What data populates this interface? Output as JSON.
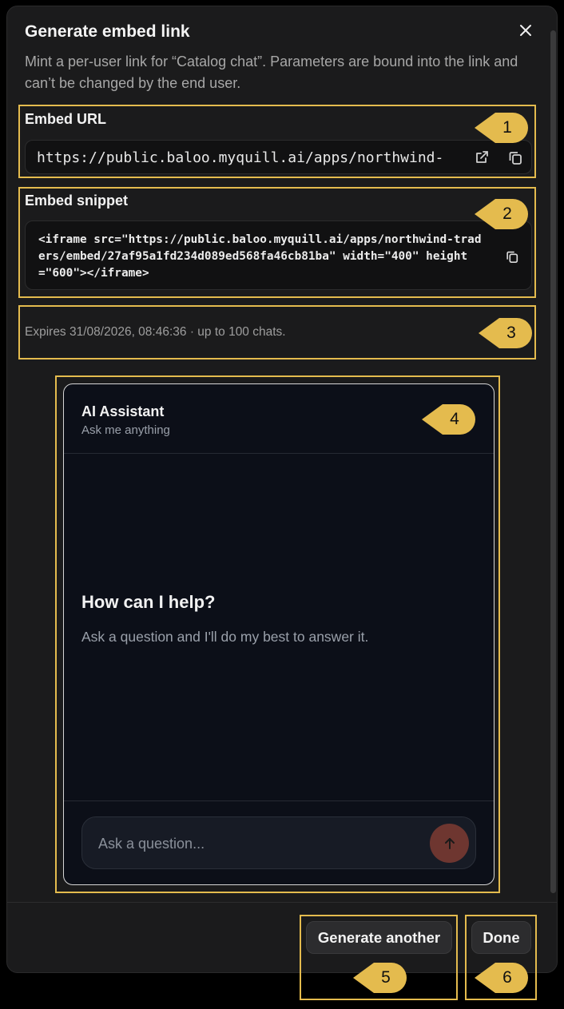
{
  "dialog": {
    "title": "Generate embed link",
    "description": "Mint a per-user link for “Catalog chat”. Parameters are bound into the link and can’t be changed by the end user.",
    "close_icon": "close-icon"
  },
  "embed_url": {
    "label": "Embed URL",
    "value": "https://public.baloo.myquill.ai/apps/northwind-",
    "open_icon": "external-link-icon",
    "copy_icon": "copy-icon"
  },
  "embed_snippet": {
    "label": "Embed snippet",
    "value": "<iframe src=\"https://public.baloo.myquill.ai/apps/northwind-traders/embed/27af95a1fd234d089ed568fa46cb81ba\" width=\"400\" height=\"600\"></iframe>",
    "copy_icon": "copy-icon"
  },
  "expiry": {
    "text": "Expires 31/08/2026, 08:46:36 · up to 100 chats."
  },
  "preview": {
    "title": "AI Assistant",
    "subtitle": "Ask me anything",
    "heading": "How can I help?",
    "subheading": "Ask a question and I'll do my best to answer it.",
    "input_placeholder": "Ask a question...",
    "send_icon": "arrow-up-icon"
  },
  "footer": {
    "generate_another_label": "Generate another",
    "done_label": "Done"
  },
  "annotations": [
    "1",
    "2",
    "3",
    "4",
    "5",
    "6"
  ],
  "colors": {
    "annotation": "#e4bb4e",
    "dialog_bg": "#1b1b1c",
    "preview_bg": "#0c0f18",
    "send_button": "#6e3630"
  }
}
